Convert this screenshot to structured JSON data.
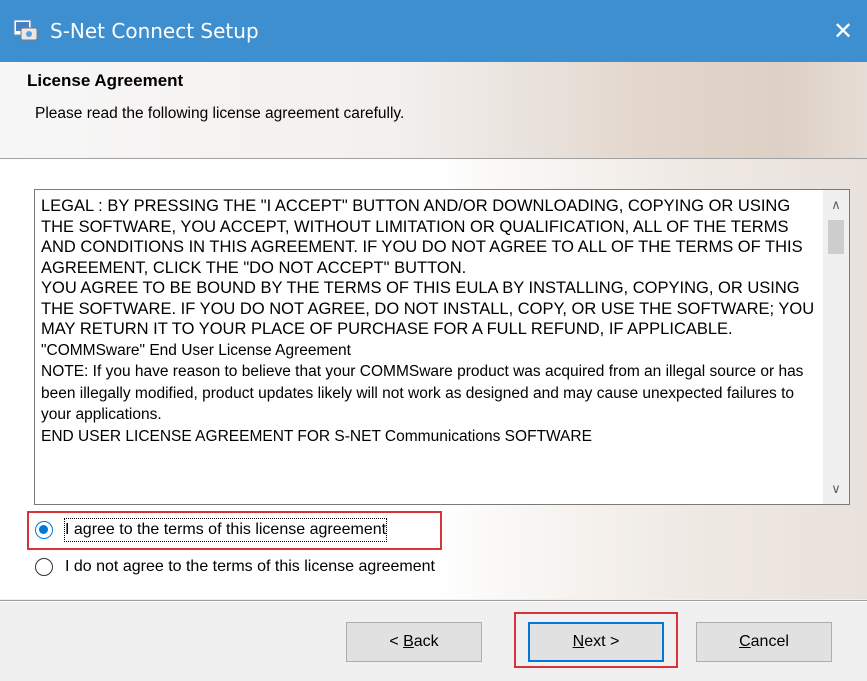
{
  "window": {
    "title": "S-Net Connect Setup",
    "close_glyph": "✕",
    "icon": "setup-installer-icon",
    "titlebar_color": "#3e8fd0"
  },
  "header": {
    "title": "License Agreement",
    "subtitle": "Please read the following license agreement carefully."
  },
  "license": {
    "paragraphs": [
      "LEGAL : BY PRESSING THE \"I ACCEPT\" BUTTON AND/OR DOWNLOADING, COPYING OR USING THE SOFTWARE, YOU ACCEPT, WITHOUT LIMITATION OR QUALIFICATION, ALL OF THE TERMS AND CONDITIONS IN THIS AGREEMENT. IF YOU DO NOT AGREE TO ALL OF THE TERMS OF THIS AGREEMENT, CLICK THE \"DO NOT ACCEPT\" BUTTON.",
      "YOU AGREE TO BE BOUND BY THE TERMS OF THIS EULA BY INSTALLING, COPYING, OR USING THE SOFTWARE. IF YOU DO NOT AGREE, DO NOT INSTALL, COPY, OR USE THE SOFTWARE; YOU MAY RETURN IT TO YOUR PLACE OF PURCHASE FOR A FULL REFUND, IF APPLICABLE.",
      "\"COMMSware\" End User License Agreement",
      "NOTE: If you have reason to believe that your COMMSware product was acquired from an illegal source or has been illegally modified, product updates likely will not work as designed and may cause unexpected failures to your applications.",
      "END USER LICENSE AGREEMENT FOR S-NET Communications SOFTWARE"
    ],
    "scroll_up_glyph": "∧",
    "scroll_down_glyph": "∨"
  },
  "options": {
    "agree_label": "I agree to the terms of this license agreement",
    "disagree_label": "I do not agree to the terms of this license agreement",
    "selected": "agree"
  },
  "buttons": {
    "back_label": "Back",
    "back_prefix": "< ",
    "back_mnemonic": "B",
    "back_rest": "ack",
    "next_mnemonic": "N",
    "next_rest": "ext >",
    "cancel_mnemonic": "C",
    "cancel_rest": "ancel"
  },
  "colors": {
    "accent": "#0078d7",
    "highlight": "#d9333a"
  }
}
